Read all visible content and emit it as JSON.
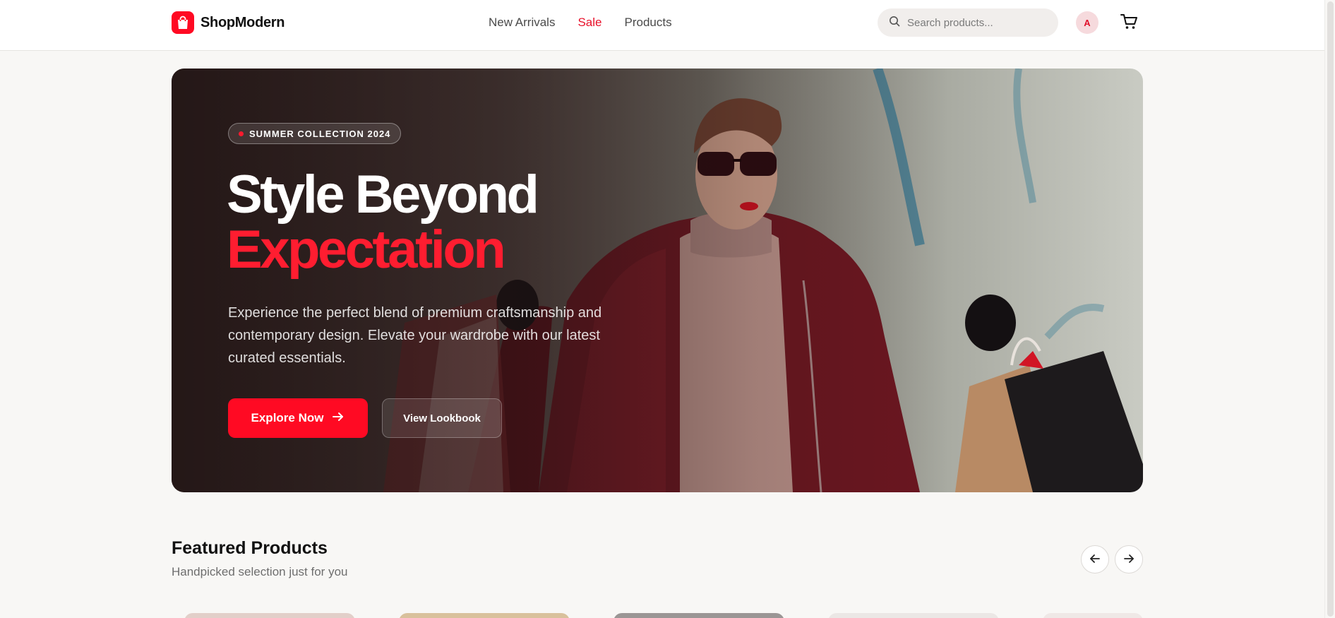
{
  "brand": {
    "name": "ShopModern",
    "color": "#ff0a23"
  },
  "nav": {
    "items": [
      {
        "label": "New Arrivals"
      },
      {
        "label": "Sale"
      },
      {
        "label": "Products"
      }
    ],
    "active": "Sale"
  },
  "search": {
    "placeholder": "Search products...",
    "value": ""
  },
  "user": {
    "avatar_initial": "A"
  },
  "icons": {
    "logo": "shopping-bag-icon",
    "search": "search-icon",
    "cart": "cart-icon",
    "explore_arrow": "arrow-right-icon",
    "prev": "arrow-left-icon",
    "next": "arrow-right-icon"
  },
  "hero": {
    "badge": "SUMMER COLLECTION 2024",
    "headline_line1": "Style Beyond",
    "headline_line2": "Expectation",
    "description": "Experience the perfect blend of premium craftsmanship and contemporary design. Elevate your wardrobe with our latest curated essentials.",
    "primary_cta": "Explore Now",
    "secondary_cta": "View Lookbook"
  },
  "featured": {
    "title": "Featured Products",
    "subtitle": "Handpicked selection just for you"
  }
}
